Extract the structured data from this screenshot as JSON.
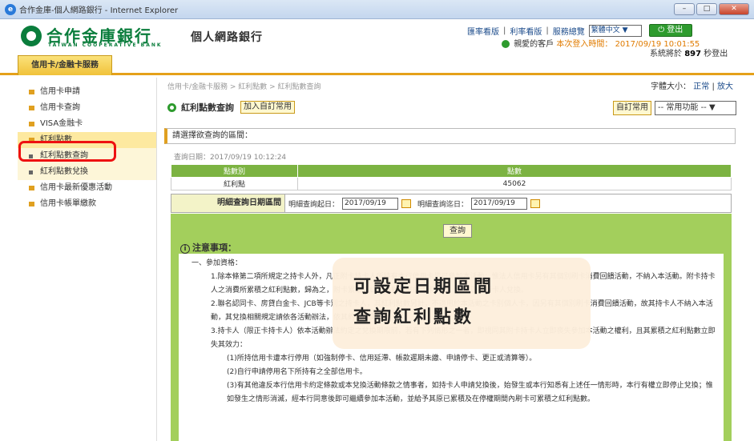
{
  "browser": {
    "title": "合作金庫-個人網路銀行 - Internet Explorer",
    "minimize": "–",
    "restore": "□",
    "close": "✕"
  },
  "header": {
    "logo_cn": "合作金庫銀行",
    "logo_en": "TAIWAN COOPERATIVE BANK",
    "site_name": "個人網路銀行",
    "links": [
      "匯率看版",
      "利率看版",
      "服務總覽"
    ],
    "language": "繁體中文 ▼",
    "logout": "⏻ 登出",
    "greeting": "親愛的客戶",
    "login_label": "本次登入時間：",
    "login_time": "2017/09/19 10:01:55",
    "session_prefix": "系統將於",
    "session_seconds": "897",
    "session_suffix": "秒登出"
  },
  "main_tab": "信用卡/金融卡服務",
  "sidebar": {
    "items": [
      {
        "label": "信用卡申請"
      },
      {
        "label": "信用卡查詢"
      },
      {
        "label": "VISA金融卡"
      },
      {
        "label": "紅利點數"
      },
      {
        "label": "紅利點數查詢"
      },
      {
        "label": "紅利點數兌換"
      },
      {
        "label": "信用卡最新優惠活動"
      },
      {
        "label": "信用卡帳單繳款"
      }
    ]
  },
  "content": {
    "breadcrumb": "信用卡/金融卡服務 > 紅利點數 > 紅利點數查詢",
    "font_size_label": "字體大小：",
    "font_normal": "正常",
    "font_large": "放大",
    "page_title": "紅利點數查詢",
    "add_favorite": "加入自訂常用",
    "favorite_label": "自訂常用",
    "function_select": "-- 常用功能 --  ▼",
    "prompt": "請選擇欲查詢的區間：",
    "query_date": "查詢日期：2017/09/19 10:12:24",
    "table": {
      "headers": [
        "點數別",
        "點數"
      ],
      "rows": [
        [
          "紅利點",
          "45062"
        ]
      ]
    },
    "date_range": {
      "label": "明細查詢日期區間",
      "start_label": "明細查詢起日：",
      "start_value": "2017/09/19",
      "end_label": "明細查詢迄日：",
      "end_value": "2017/09/19"
    },
    "query_button": "查詢",
    "notice_title": "注意事項：",
    "notice": {
      "h1": "一、參加資格：",
      "p1": "1.除本條第二項所規定之持卡人外，凡正附卡持卡人所持有本行信用卡皆可參加本活動；惟法人信用卡另有其個別刷卡消費回饋活動，不納入本活動。附卡持卡人之消費所累積之紅利點數，歸為之，附卡累積之紅利點數合併於正卡計算，而由正卡持卡人兌換。",
      "p2": "2.聯名認同卡、房貸白金卡、JCB等卡別之持卡人，其紅利點數另計，不適用於本活動之卡別個人卡，因另有其個別刷卡消費回饋活動，故其持卡人不納入本活動，其兌換相關規定請依各活動辦法，依其約定不同。",
      "p3": "3.持卡人（限正卡持卡人）依本活動辦法約定之兌換期限前，若有下列情形之一者，即視同其附卡持卡人立即喪失參加本活動之權利，且其累積之紅利點數立即失其效力：",
      "p3_1": "(1)所持信用卡遭本行停用（如強制停卡、信用延滯、帳款遲期未繳、申請停卡、更正或清算等）。",
      "p3_2": "(2)自行申請停用名下所持有之全部信用卡。",
      "p3_3": "(3)有其他違反本行信用卡約定條款或本兌換活動條款之情事者，如持卡人申請兌換後，始發生或本行知悉有上述任一情形時，本行有權立即停止兌換；惟如發生之情形消滅，經本行同意後即可繼續參加本活動，並給予其原已累積及在停權期間內刷卡可累積之紅利點數。"
    }
  },
  "overlay": {
    "line1": "可設定日期區間",
    "line2": "查詢紅利點數"
  }
}
